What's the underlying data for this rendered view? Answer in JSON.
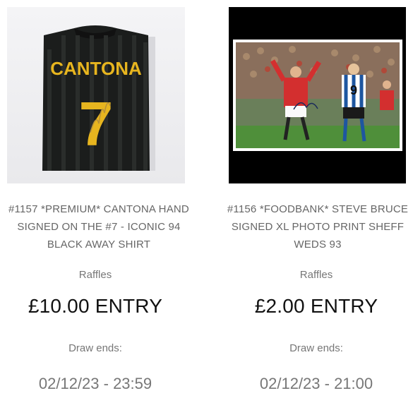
{
  "products": [
    {
      "title_line1": "#1157 *PREMIUM* CANTONA HAND",
      "title_line2": "SIGNED ON THE #7 - ICONIC 94",
      "title_line3": "BLACK AWAY SHIRT",
      "category": "Raffles",
      "price": "£10.00 ENTRY",
      "draw_label": "Draw ends:",
      "draw_date": "02/12/23 - 23:59",
      "image": {
        "shirt_name": "CANTONA",
        "shirt_number": "7"
      }
    },
    {
      "title_line1": "#1156 *FOODBANK* STEVE BRUCE",
      "title_line2": "SIGNED XL PHOTO PRINT SHEFF",
      "title_line3": "WEDS 93",
      "category": "Raffles",
      "price": "£2.00 ENTRY",
      "draw_label": "Draw ends:",
      "draw_date": "02/12/23 - 21:00",
      "image": {
        "player_number": "9"
      }
    }
  ]
}
